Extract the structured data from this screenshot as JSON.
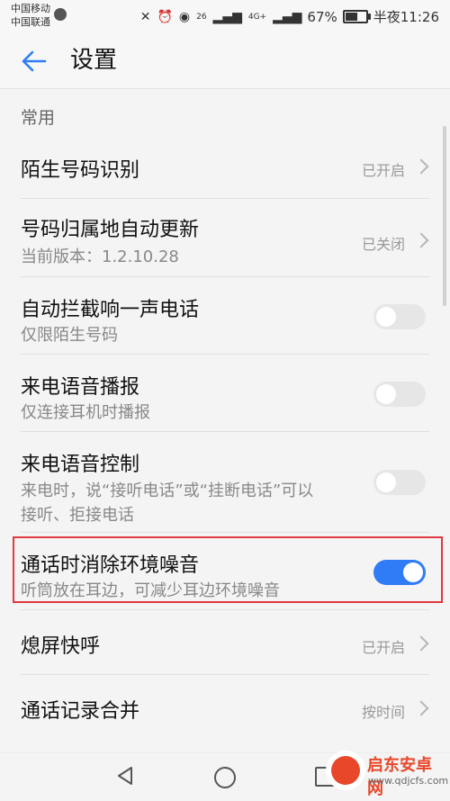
{
  "status_bar": {
    "carrier_1": "中国移动",
    "carrier_2": "中国联通",
    "signal_a": "26",
    "signal_b": "4G+",
    "battery": "67%",
    "battery_level": 0.67,
    "time": "半夜11:26"
  },
  "app_bar": {
    "title": "设置"
  },
  "section": {
    "header": "常用"
  },
  "rows": [
    {
      "label": "陌生号码识别",
      "value": "已开启"
    },
    {
      "label": "号码归属地自动更新",
      "sub": "当前版本：1.2.10.28",
      "value": "已关闭"
    },
    {
      "label": "自动拦截响一声电话",
      "sub": "仅限陌生号码",
      "toggle": false
    },
    {
      "label": "来电语音播报",
      "sub": "仅连接耳机时播报",
      "toggle": false
    },
    {
      "label": "来电语音控制",
      "sub_1": "来电时，说“接听电话”或“挂断电话”可以",
      "sub_2": "接听、拒接电话",
      "toggle": false
    },
    {
      "label": "通话时消除环境噪音",
      "sub": "听筒放在耳边，可减少耳边环境噪音",
      "toggle": true
    },
    {
      "label": "熄屏快呼",
      "value": "已开启"
    },
    {
      "label": "通话记录合并",
      "value": "按时间"
    }
  ],
  "watermark": {
    "title": "启东安卓网",
    "url": "www.qdjcfs.com"
  },
  "colors": {
    "accent": "#2f7cf6",
    "highlight": "#e0393e"
  }
}
